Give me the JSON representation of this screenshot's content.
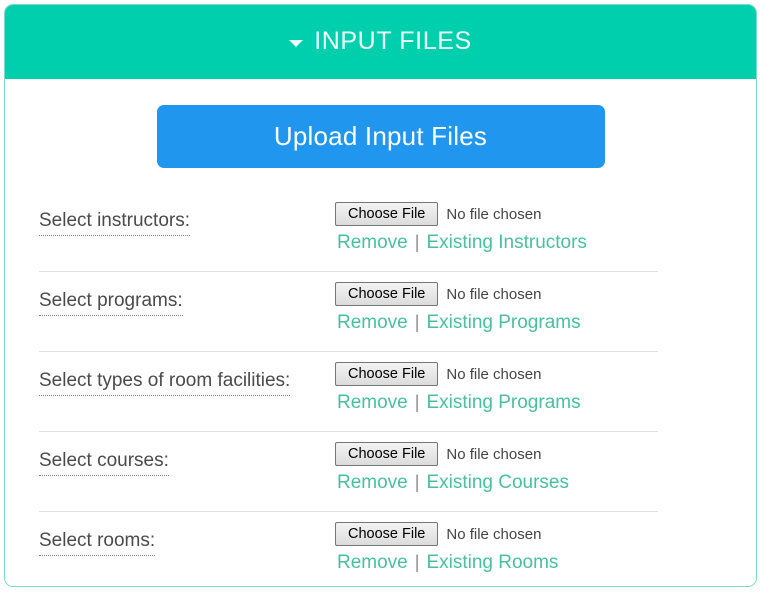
{
  "card": {
    "header": {
      "title": "INPUT FILES",
      "caret_icon": "caret-down-icon",
      "background_color": "#00cfae",
      "text_color": "#ffffff"
    },
    "upload_button": {
      "label": "Upload Input Files",
      "color": "#2196ef"
    },
    "link_color": "#49bfa2",
    "separator": "|",
    "rows": [
      {
        "label": "Select instructors:",
        "choose_file_label": "Choose File",
        "file_status": "No file chosen",
        "remove_label": "Remove",
        "existing_label": "Existing Instructors"
      },
      {
        "label": "Select programs:",
        "choose_file_label": "Choose File",
        "file_status": "No file chosen",
        "remove_label": "Remove",
        "existing_label": "Existing Programs"
      },
      {
        "label": "Select types of room facilities:",
        "choose_file_label": "Choose File",
        "file_status": "No file chosen",
        "remove_label": "Remove",
        "existing_label": "Existing Programs"
      },
      {
        "label": "Select courses:",
        "choose_file_label": "Choose File",
        "file_status": "No file chosen",
        "remove_label": "Remove",
        "existing_label": "Existing Courses"
      },
      {
        "label": "Select rooms:",
        "choose_file_label": "Choose File",
        "file_status": "No file chosen",
        "remove_label": "Remove",
        "existing_label": "Existing Rooms"
      }
    ]
  }
}
